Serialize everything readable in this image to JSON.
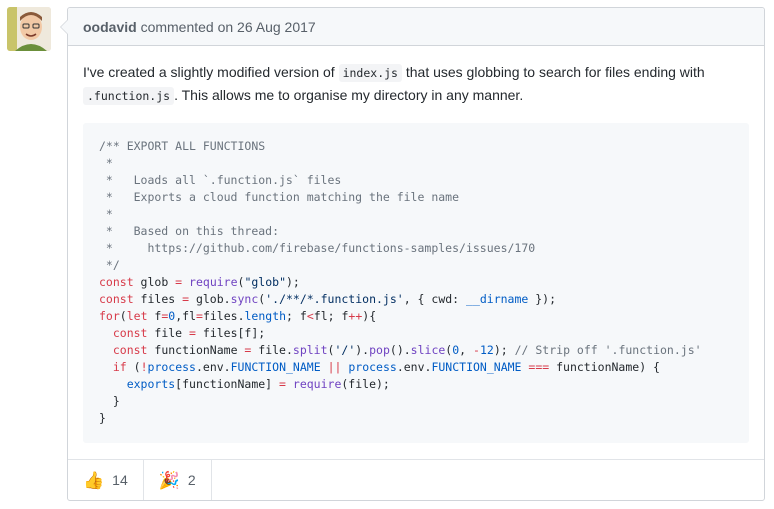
{
  "comment": {
    "author": "oodavid",
    "meta": "commented on 26 Aug 2017",
    "text_before": "I've created a slightly modified version of ",
    "code_index": "index.js",
    "text_middle": " that uses globbing to search for files ending with ",
    "code_ext": ".function.js",
    "text_after": ". This allows me to organise my directory in any manner."
  },
  "reactions": [
    {
      "emoji": "thumbs-up-icon",
      "count": "14"
    },
    {
      "emoji": "party-popper-icon",
      "count": "2"
    }
  ],
  "colors": {
    "border": "#d1d5da",
    "header_bg": "#f6f8fa",
    "keyword": "#d73a49",
    "function": "#6f42c1",
    "string": "#032f62",
    "constant": "#005cc5",
    "comment": "#6a737d"
  },
  "code_lines": [
    "/** EXPORT ALL FUNCTIONS",
    " *",
    " *   Loads all `.function.js` files",
    " *   Exports a cloud function matching the file name",
    " *",
    " *   Based on this thread:",
    " *     https://github.com/firebase/functions-samples/issues/170",
    " */",
    "const glob = require(\"glob\");",
    "const files = glob.sync('./**/*.function.js', { cwd: __dirname });",
    "for(let f=0,fl=files.length; f<fl; f++){",
    "  const file = files[f];",
    "  const functionName = file.split('/').pop().slice(0, -12); // Strip off '.function.js'",
    "  if (!process.env.FUNCTION_NAME || process.env.FUNCTION_NAME === functionName) {",
    "    exports[functionName] = require(file);",
    "  }",
    "}"
  ]
}
